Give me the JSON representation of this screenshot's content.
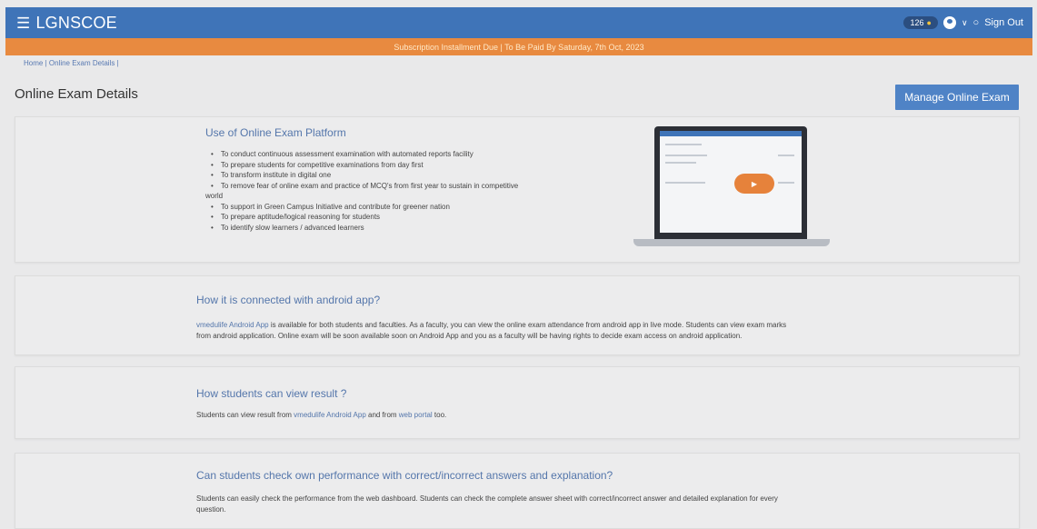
{
  "header": {
    "brand": "LGNSCOE",
    "badge_count": "126",
    "sign_out": "Sign Out"
  },
  "notice": "Subscription Installment Due | To Be Paid By Saturday, 7th Oct, 2023",
  "breadcrumb": {
    "home": "Home",
    "current": "Online Exam Details"
  },
  "page": {
    "title": "Online Exam Details",
    "manage_button": "Manage Online Exam"
  },
  "section1": {
    "title": "Use of Online Exam Platform",
    "bullets": [
      "To conduct continuous assessment examination with automated reports facility",
      "To prepare students for competitive examinations from day first",
      "To transform institute in digital one",
      "To remove fear of online exam and practice of MCQ's from first year to sustain in competitive world",
      "To support in Green Campus Initiative and contribute for greener nation",
      "To prepare aptitude/logical reasoning for students",
      "To identify slow learners / advanced learners"
    ]
  },
  "section2": {
    "title": "How it is connected with android app?",
    "link": "vmedulife Android App",
    "line1": " is available for both students and faculties. As a faculty, you can view the online exam attendance from android app in live mode. Students can view exam marks",
    "line2": "from android application. Online exam will be soon available soon on Android App and you as a faculty will be having rights to decide exam access on android application."
  },
  "section3": {
    "title": "How students can view result ?",
    "prefix": "Students can view result from ",
    "link1": "vmedulife Android App",
    "middle": " and from ",
    "link2": "web portal",
    "suffix": " too."
  },
  "section4": {
    "title": "Can students check own performance with correct/incorrect answers and explanation?",
    "line1": "Students can easily check the performance from the web dashboard. Students can check the complete answer sheet with correct/incorrect answer and detailed explanation for every",
    "line2": "question."
  }
}
